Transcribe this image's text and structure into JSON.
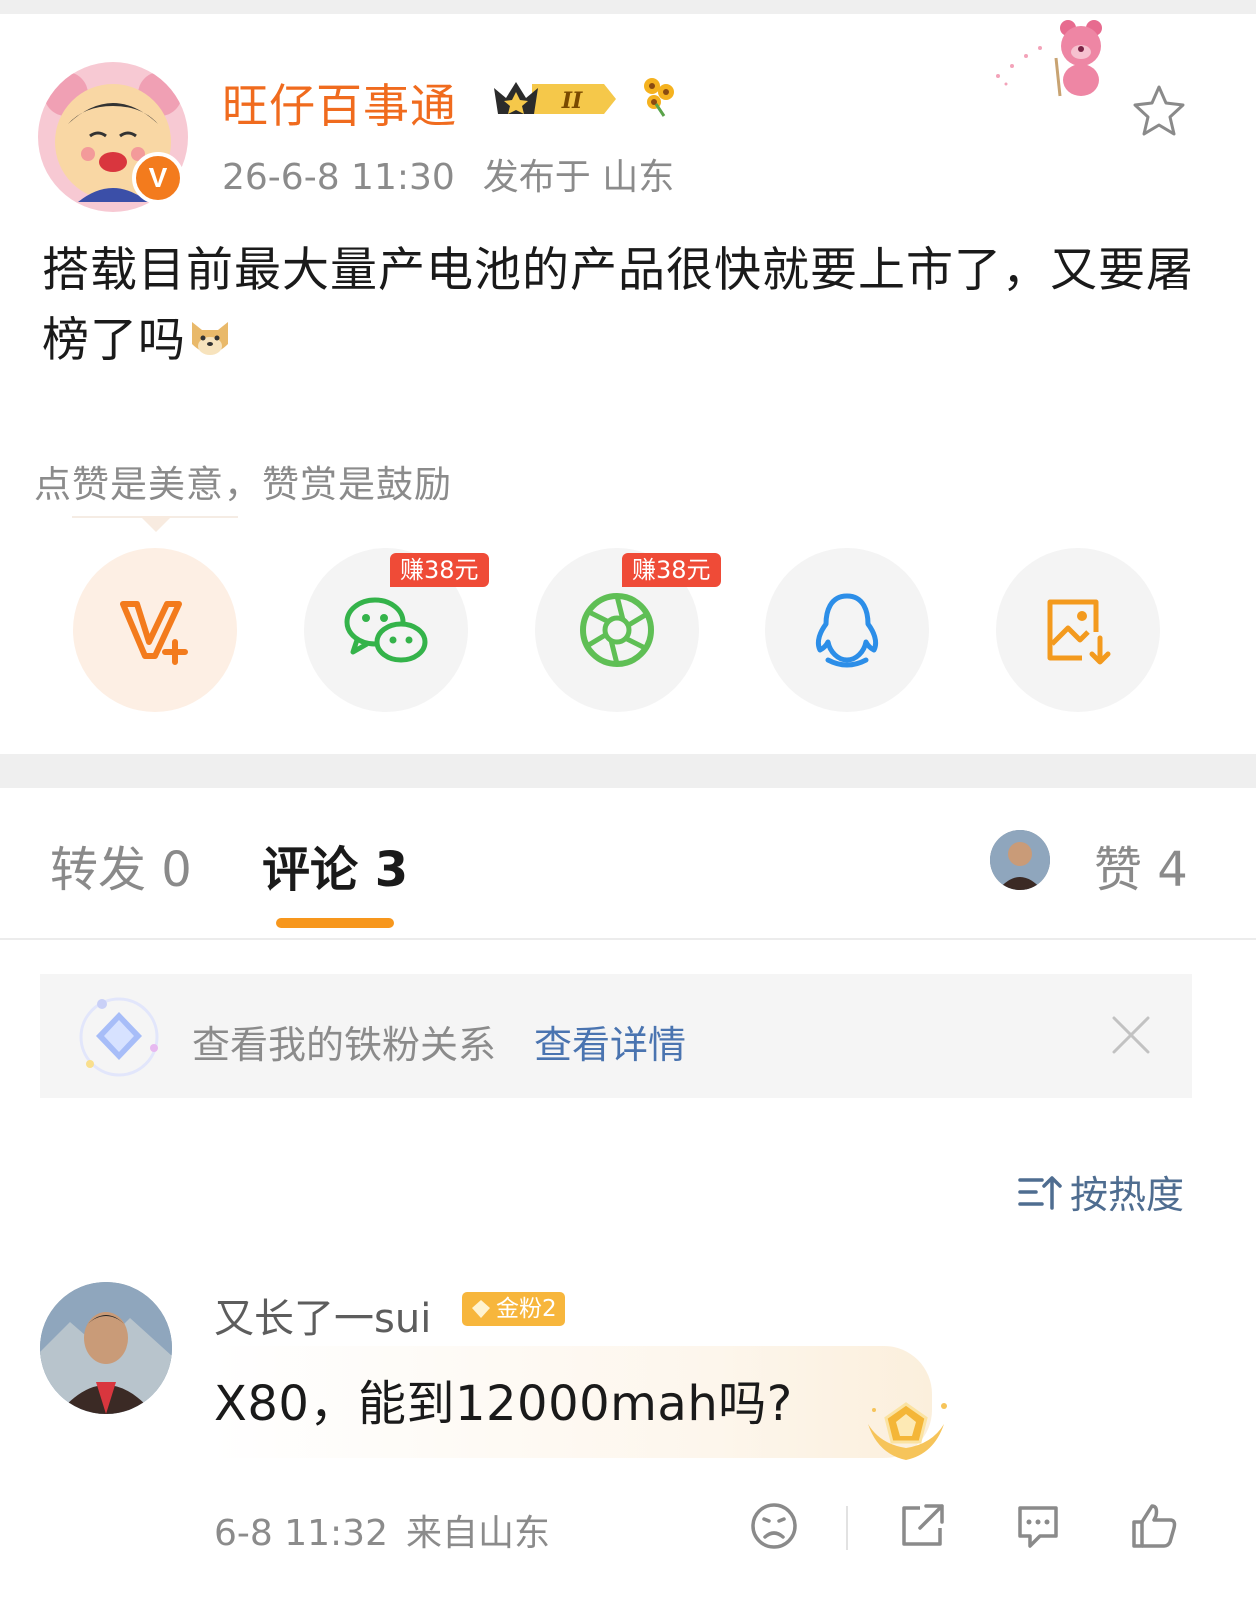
{
  "post": {
    "author": "旺仔百事通",
    "time": "26-6-8 11:30",
    "location": "发布于 山东",
    "text": "搭载目前最大量产电池的产品很快就要上市了，又要屠榜了吗",
    "level_badge": "II"
  },
  "reward": {
    "prompt": "点赞是美意，赞赏是鼓励"
  },
  "share": {
    "items": [
      {
        "icon": "weibo-v-plus-icon"
      },
      {
        "icon": "wechat-icon",
        "badge": "赚38元"
      },
      {
        "icon": "moments-icon",
        "badge": "赚38元"
      },
      {
        "icon": "qq-icon"
      },
      {
        "icon": "save-image-icon"
      }
    ]
  },
  "tabs": {
    "repost": "转发 0",
    "comment": "评论 3",
    "like": "赞 4"
  },
  "fan_bar": {
    "text": "查看我的铁粉关系",
    "link": "查看详情"
  },
  "sort": {
    "label": "按热度"
  },
  "comment": {
    "author": "又长了一sui",
    "badge": "金粉2",
    "text": "X80，能到12000mah吗?",
    "time": "6-8 11:32",
    "source": "来自山东"
  },
  "colors": {
    "brand_orange": "#f06b1e",
    "tab_indicator": "#f7971d",
    "link_blue": "#4a74b0",
    "earn_red": "#ef4b37",
    "fan_gold": "#f7b63c"
  }
}
